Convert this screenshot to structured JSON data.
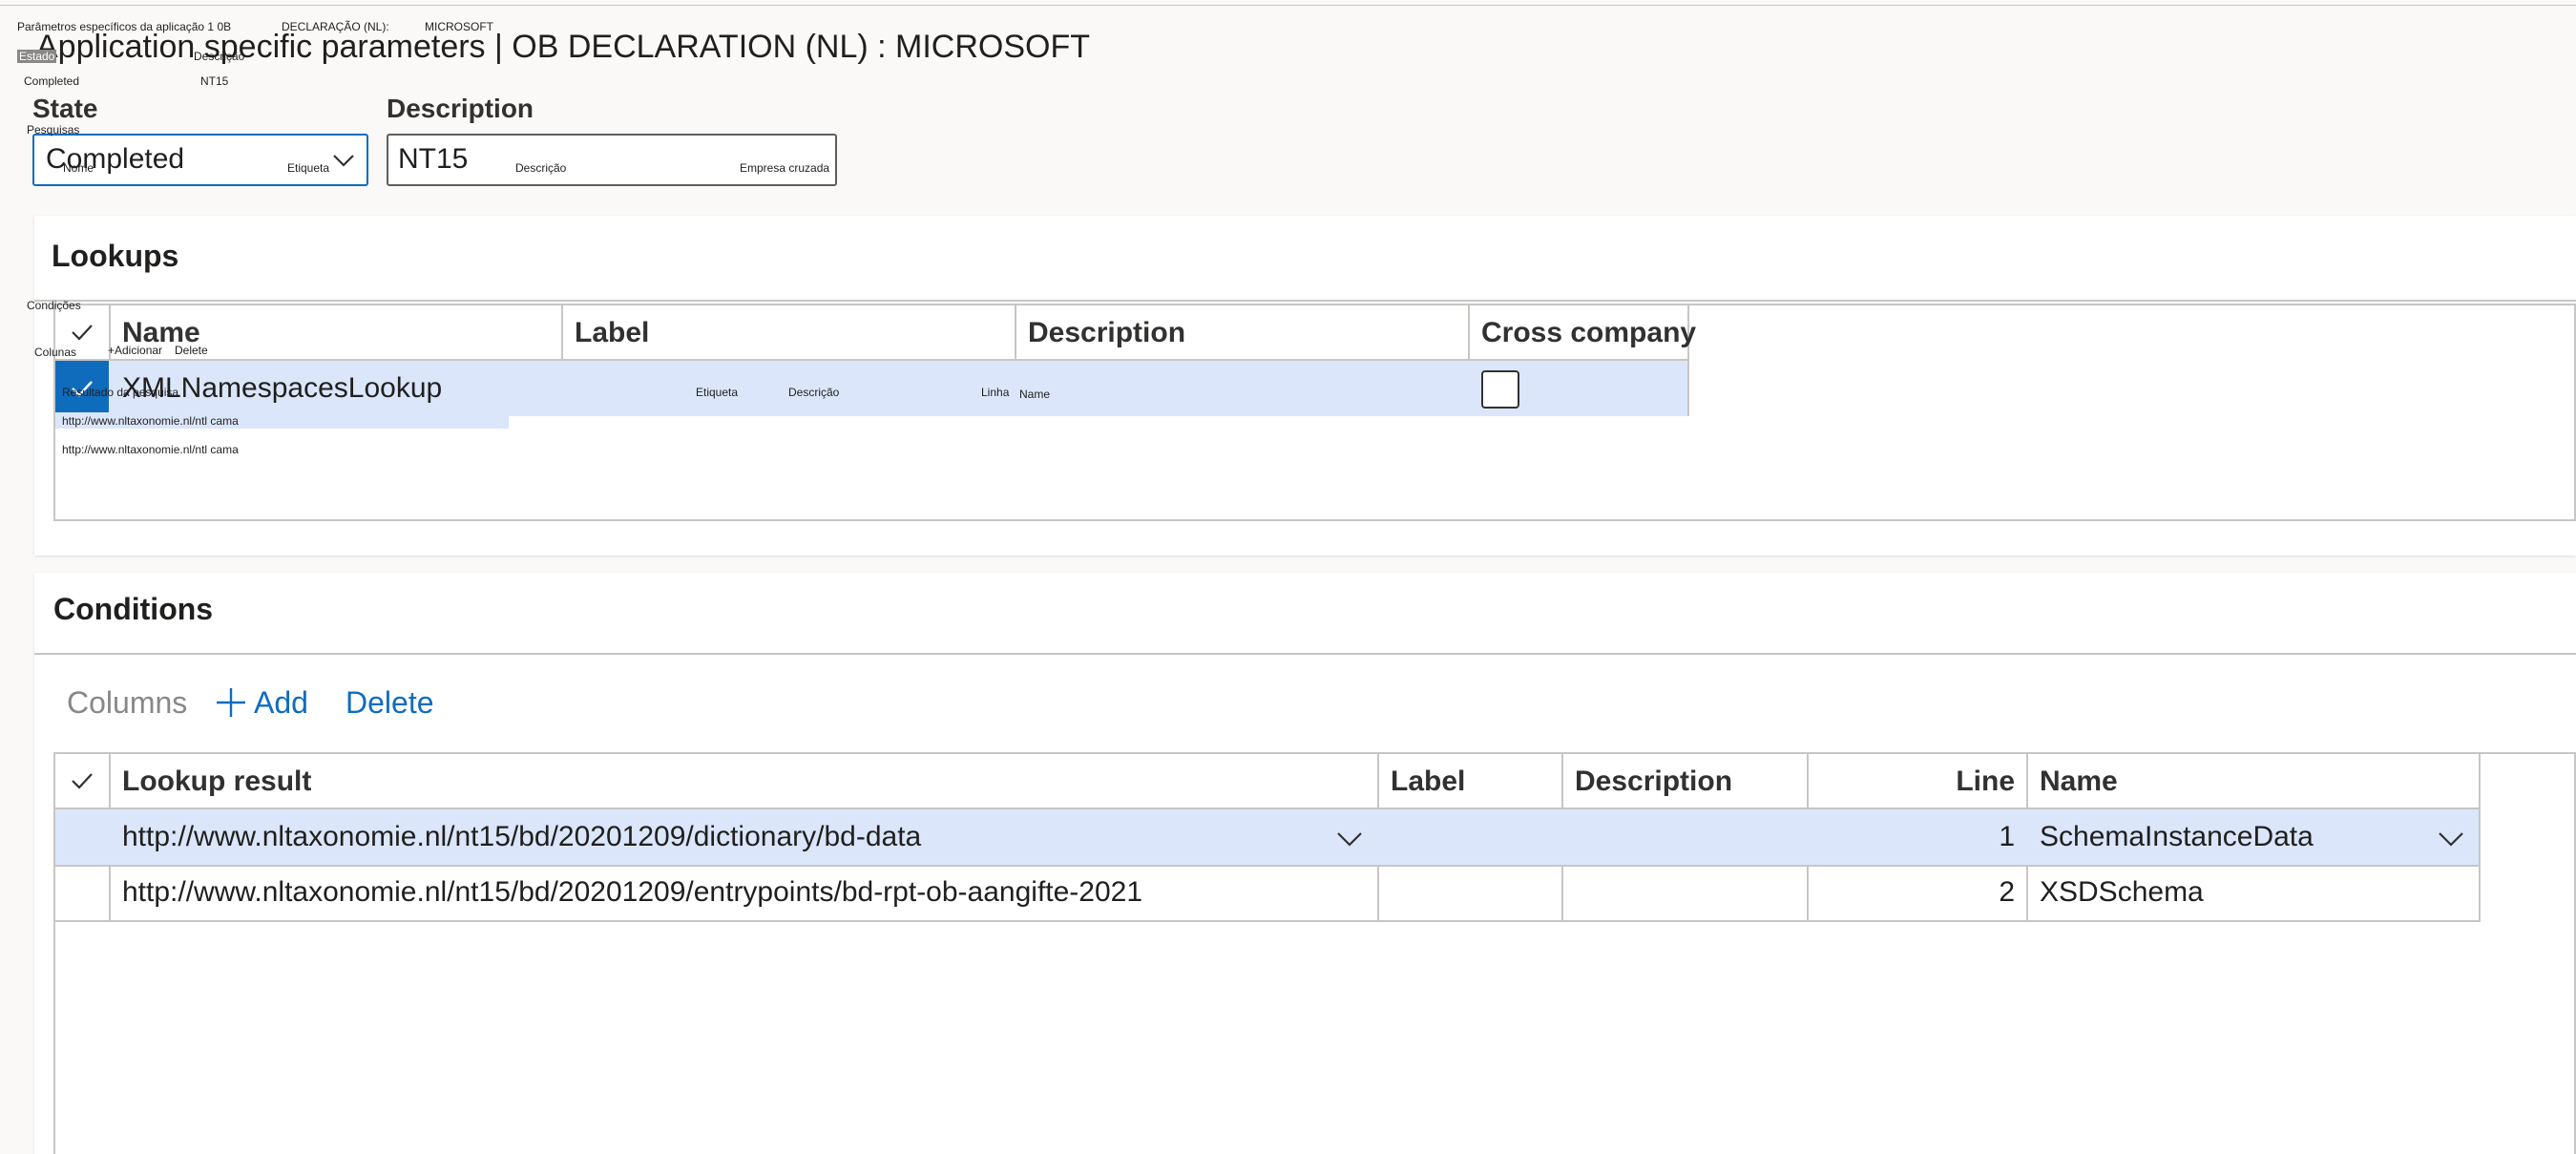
{
  "overlay": {
    "title_pt": "Parâmetros específicos da aplicação 1 0B",
    "declaration_pt": "DECLARAÇÃO (NL):",
    "company_pt": "MICROSOFT",
    "estado_pt": "Estado",
    "descricao_pt": "Descrição",
    "completed_pt": "Completed",
    "nt15_pt": "NT15",
    "pesquisas_pt": "Pesquisas",
    "nome_pt": "Nome",
    "etiqueta_pt": "Etiqueta",
    "descricao2_pt": "Descrição",
    "empresa_pt": "Empresa cruzada",
    "condicoes_pt": "Condições",
    "colunas_pt": "Colunas",
    "adicionar_pt": "+Adicionar",
    "delete_pt": "Delete",
    "resultado_pt": "Resultado da pesquisa",
    "etiqueta2_pt": "Etiqueta",
    "descricao3_pt": "Descrição",
    "linha_pt": "Linha",
    "name_pt": "Name",
    "url1_pt": "http://www.nltaxonomie.nl/ntl cama",
    "url2_pt": "http://www.nltaxonomie.nl/ntl cama"
  },
  "header": {
    "title": "Application specific parameters  |  OB DECLARATION (NL) : MICROSOFT",
    "state_label": "State",
    "state_value": "Completed",
    "description_label": "Description",
    "description_value": "NT15"
  },
  "lookups": {
    "title": "Lookups",
    "columns": [
      "Name",
      "Label",
      "Description",
      "Cross company"
    ],
    "rows": [
      {
        "name": "XMLNamespacesLookup",
        "label": "",
        "description": "",
        "cross_company": false
      }
    ]
  },
  "conditions": {
    "title": "Conditions",
    "toolbar": {
      "columns": "Columns",
      "add": "Add",
      "delete": "Delete"
    },
    "columns": [
      "Lookup result",
      "Label",
      "Description",
      "Line",
      "Name"
    ],
    "rows": [
      {
        "lookup_result": "http://www.nltaxonomie.nl/nt15/bd/20201209/dictionary/bd-data",
        "label": "",
        "description": "",
        "line": "1",
        "name": "SchemaInstanceData"
      },
      {
        "lookup_result": "http://www.nltaxonomie.nl/nt15/bd/20201209/entrypoints/bd-rpt-ob-aangifte-2021",
        "label": "",
        "description": "",
        "line": "2",
        "name": "XSDSchema"
      }
    ]
  },
  "colors": {
    "accent": "#0f6cbd",
    "selected_row": "#dbe6fb",
    "border": "#c8c6c4"
  }
}
